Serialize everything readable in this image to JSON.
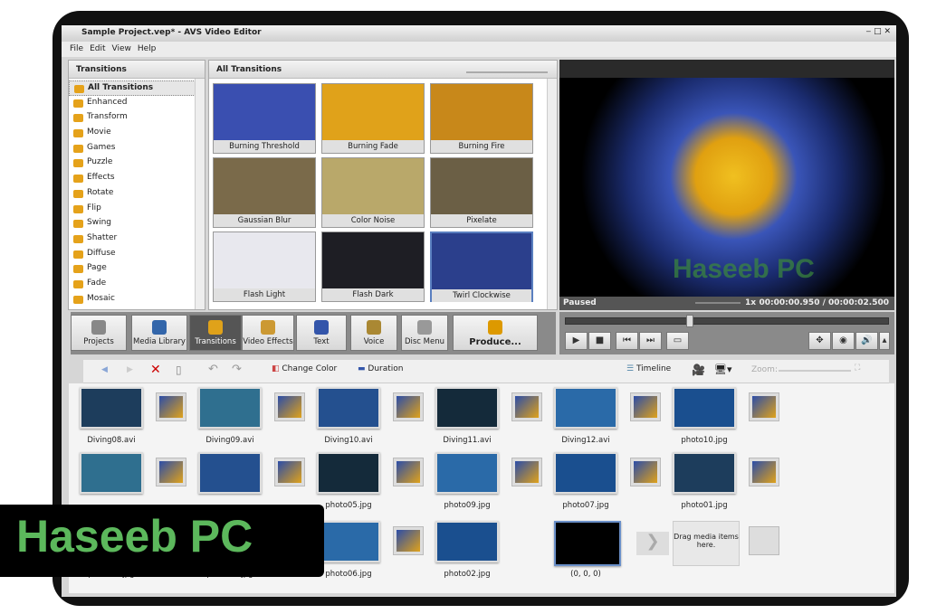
{
  "window": {
    "title": "Sample Project.vep* - AVS Video Editor"
  },
  "menu": [
    "File",
    "Edit",
    "View",
    "Help"
  ],
  "left_panel": {
    "title": "Transitions",
    "categories": [
      "All Transitions",
      "Enhanced",
      "Transform",
      "Movie",
      "Games",
      "Puzzle",
      "Effects",
      "Rotate",
      "Flip",
      "Swing",
      "Shatter",
      "Diffuse",
      "Page",
      "Fade",
      "Mosaic"
    ]
  },
  "grid": {
    "title": "All Transitions",
    "tiles": [
      {
        "label": "Burning Threshold",
        "color": "#3a4fb0"
      },
      {
        "label": "Burning Fade",
        "color": "#e0a21a"
      },
      {
        "label": "Burning Fire",
        "color": "#c8881a"
      },
      {
        "label": "Gaussian Blur",
        "color": "#7a6a4a"
      },
      {
        "label": "Color Noise",
        "color": "#b9a86a"
      },
      {
        "label": "Pixelate",
        "color": "#6b5f45"
      },
      {
        "label": "Flash Light",
        "color": "#e8e8ee"
      },
      {
        "label": "Flash Dark",
        "color": "#1e1e24"
      },
      {
        "label": "Twirl Clockwise",
        "color": "#2b3f8c"
      }
    ]
  },
  "preview": {
    "status": "Paused",
    "speed": "1x",
    "time": "00:00:00.950 / 00:00:02.500",
    "progress": 0.38,
    "watermark": "Haseeb PC"
  },
  "toolbar": [
    "Projects",
    "Media Library",
    "Transitions",
    "Video Effects",
    "Text",
    "Voice",
    "Disc Menu",
    "Produce..."
  ],
  "editbar": {
    "change_color": "Change Color",
    "duration": "Duration",
    "timeline": "Timeline",
    "zoom": "Zoom:"
  },
  "storyboard": {
    "rows": [
      [
        "Diving08.avi",
        "Diving09.avi",
        "Diving10.avi",
        "Diving11.avi",
        "Diving12.avi",
        "photo10.jpg"
      ],
      [
        "",
        "",
        "photo05.jpg",
        "photo09.jpg",
        "photo07.jpg",
        "photo01.jpg"
      ],
      [
        "photo03.jpg",
        "photo04.jpg",
        "photo06.jpg",
        "photo02.jpg",
        "(0, 0, 0)"
      ]
    ],
    "drop_hint": "Drag media items here."
  },
  "watermark": "Haseeb PC"
}
